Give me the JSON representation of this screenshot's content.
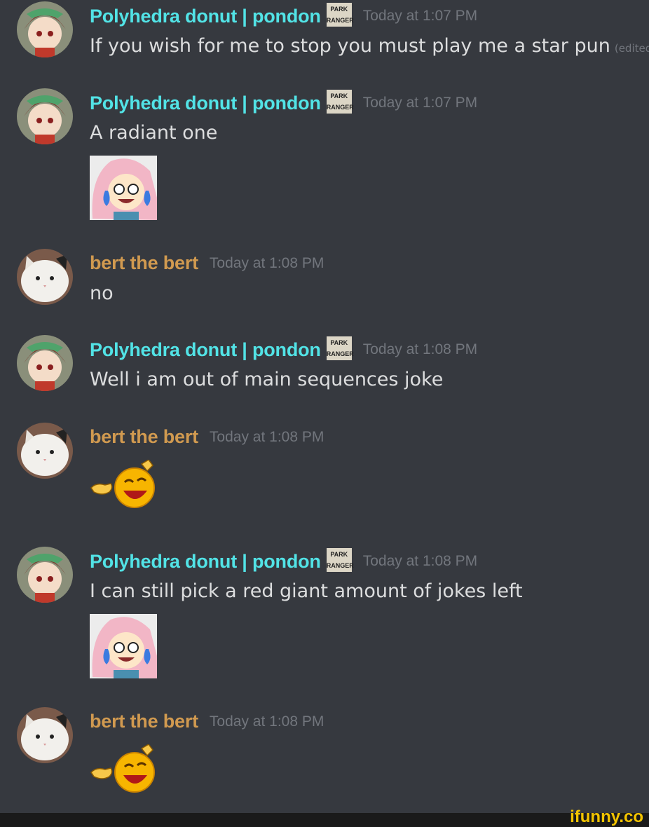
{
  "users": {
    "pondon": {
      "name": "Polyhedra donut | pondon",
      "badge": [
        "PARK",
        "RANGER"
      ]
    },
    "bert": {
      "name": "bert the bert"
    }
  },
  "messages": [
    {
      "author": "Polyhedra donut | pondon",
      "time": "Today at 1:07 PM",
      "text": "If you wish for me to stop you must play me a star pun",
      "edited": "(edited)"
    },
    {
      "author": "Polyhedra donut | pondon",
      "time": "Today at 1:07 PM",
      "text": "A radiant one",
      "sticker": "crying-laughing-anime-girl"
    },
    {
      "author": "bert the bert",
      "time": "Today at 1:08 PM",
      "text": "no"
    },
    {
      "author": "Polyhedra donut | pondon",
      "time": "Today at 1:08 PM",
      "text": "Well i am out of main sequences joke"
    },
    {
      "author": "bert the bert",
      "time": "Today at 1:08 PM",
      "emoji": "point-laughing-emoji"
    },
    {
      "author": "Polyhedra donut | pondon",
      "time": "Today at 1:08 PM",
      "text": "I can still pick a red giant amount of jokes left",
      "sticker": "crying-laughing-anime-girl"
    },
    {
      "author": "bert the bert",
      "time": "Today at 1:08 PM",
      "emoji": "point-laughing-emoji"
    }
  ],
  "watermark": "ifunny.co",
  "colors": {
    "background": "#36393f",
    "pondon_name": "#52e3e6",
    "bert_name": "#d19a50",
    "timestamp": "#72767d",
    "text": "#dcddde"
  }
}
